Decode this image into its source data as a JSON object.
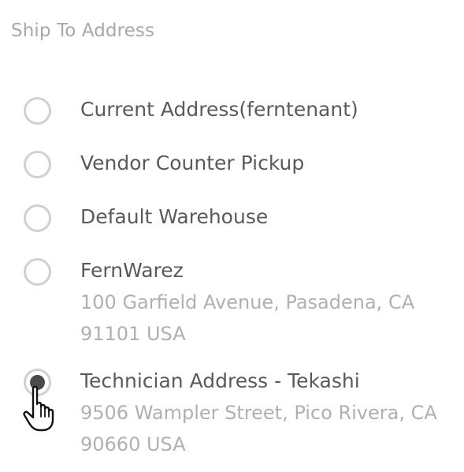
{
  "section": {
    "title": "Ship To Address"
  },
  "options": [
    {
      "label": "Current Address(ferntenant)",
      "selected": false
    },
    {
      "label": "Vendor Counter Pickup",
      "selected": false
    },
    {
      "label": "Default Warehouse",
      "selected": false
    },
    {
      "label": "FernWarez",
      "address_line1": "100 Garfield Avenue, Pasadena, CA",
      "address_line2": "91101 USA",
      "selected": false
    },
    {
      "label": "Technician Address - Tekashi",
      "address_line1": "9506 Wampler Street, Pico Rivera, CA",
      "address_line2": "90660 USA",
      "selected": true
    }
  ],
  "icons": {
    "cursor": "hand-pointer-icon"
  },
  "colors": {
    "radio_border": "#d0d0d0",
    "radio_fill": "#4a4a4a",
    "title": "#a8a8a8",
    "label": "#5a5a5a",
    "address": "#b0b0b0"
  }
}
